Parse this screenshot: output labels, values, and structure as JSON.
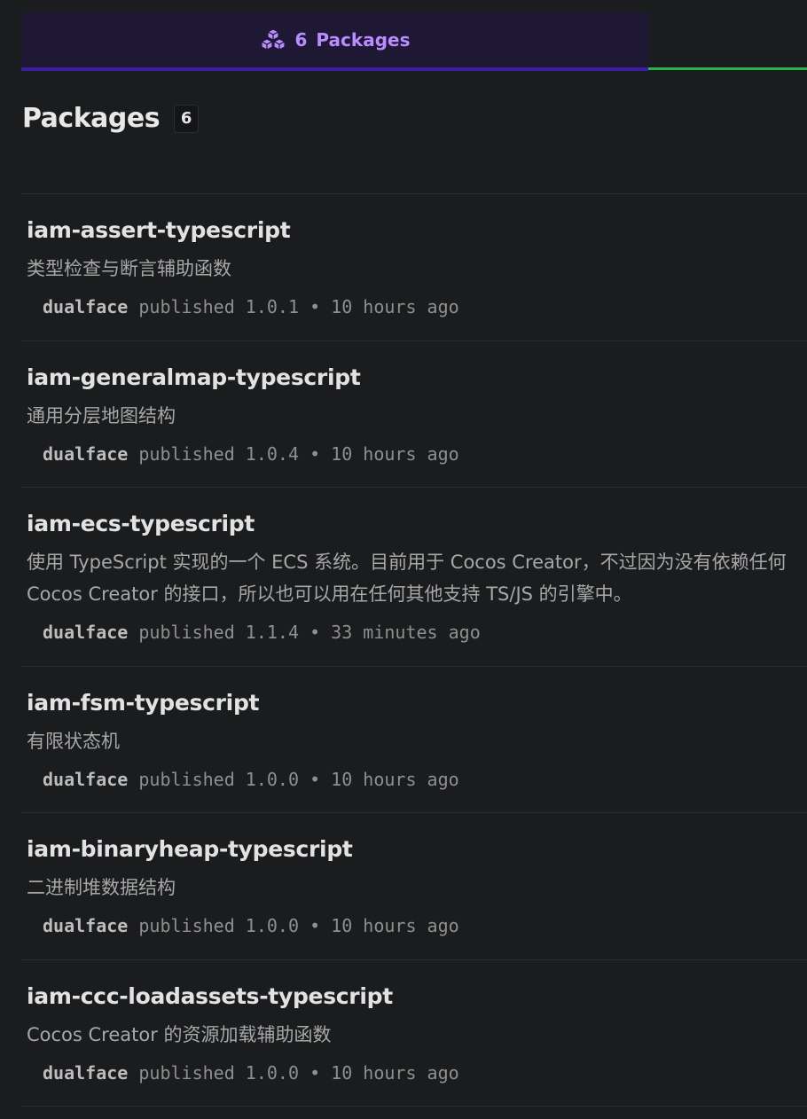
{
  "tab": {
    "count": "6",
    "label": "Packages",
    "icon": "packages-icon",
    "active_color": "#b98cff",
    "underline_color": "#26b34a"
  },
  "heading": {
    "title": "Packages",
    "count": "6"
  },
  "packages": [
    {
      "name": "iam-assert-typescript",
      "description": "类型检查与断言辅助函数",
      "author": "dualface",
      "action": "published",
      "version": "1.0.1",
      "time": "10 hours ago"
    },
    {
      "name": "iam-generalmap-typescript",
      "description": "通用分层地图结构",
      "author": "dualface",
      "action": "published",
      "version": "1.0.4",
      "time": "10 hours ago"
    },
    {
      "name": "iam-ecs-typescript",
      "description": "使用 TypeScript 实现的一个 ECS 系统。目前用于 Cocos Creator，不过因为没有依赖任何 Cocos Creator 的接口，所以也可以用在任何其他支持 TS/JS 的引擎中。",
      "author": "dualface",
      "action": "published",
      "version": "1.1.4",
      "time": "33 minutes ago"
    },
    {
      "name": "iam-fsm-typescript",
      "description": "有限状态机",
      "author": "dualface",
      "action": "published",
      "version": "1.0.0",
      "time": "10 hours ago"
    },
    {
      "name": "iam-binaryheap-typescript",
      "description": "二进制堆数据结构",
      "author": "dualface",
      "action": "published",
      "version": "1.0.0",
      "time": "10 hours ago"
    },
    {
      "name": "iam-ccc-loadassets-typescript",
      "description": "Cocos Creator 的资源加载辅助函数",
      "author": "dualface",
      "action": "published",
      "version": "1.0.0",
      "time": "10 hours ago"
    }
  ]
}
